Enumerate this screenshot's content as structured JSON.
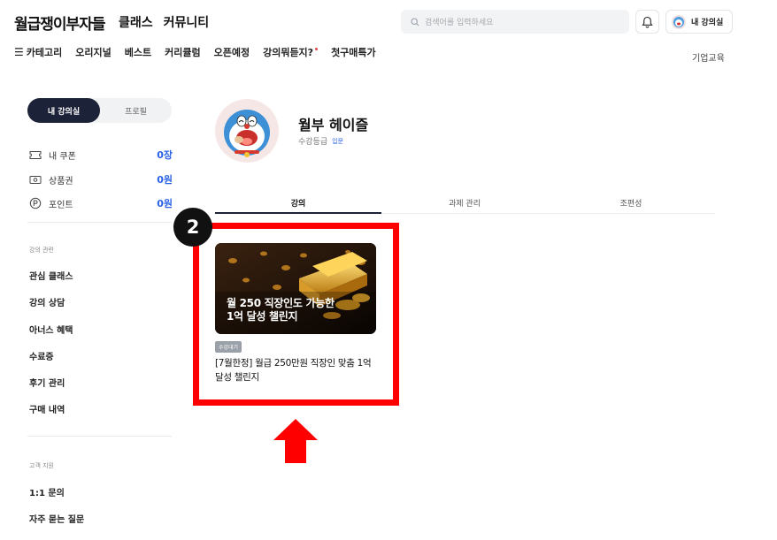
{
  "header": {
    "logo": "월급쟁이부자들",
    "nav": [
      "클래스",
      "커뮤니티"
    ],
    "search_placeholder": "검색어를 입력하세요",
    "my_class_label": "내 강의실"
  },
  "subnav": {
    "items": [
      "카테고리",
      "오리지널",
      "베스트",
      "커리큘럼",
      "오픈예정",
      "강의뭐듣지?",
      "첫구매특가"
    ],
    "corporate": "기업교육"
  },
  "sidebar": {
    "tabs": [
      "내 강의실",
      "프로필"
    ],
    "wallet": [
      {
        "label": "내 쿠폰",
        "value": "0장",
        "icon": "ticket-icon"
      },
      {
        "label": "상품권",
        "value": "0원",
        "icon": "voucher-icon"
      },
      {
        "label": "포인트",
        "value": "0원",
        "icon": "point-icon"
      }
    ],
    "lecture_section": "강의 관련",
    "lecture_items": [
      "관심 클래스",
      "강의 상담",
      "아너스 혜택",
      "수료증",
      "후기 관리",
      "구매 내역"
    ],
    "support_section": "고객 지원",
    "support_items": [
      "1:1 문의",
      "자주 묻는 질문"
    ]
  },
  "profile": {
    "name": "월부 헤이즐",
    "grade_label": "수강등급",
    "grade_value": "입문"
  },
  "content_tabs": [
    "강의",
    "과제 관리",
    "조편성"
  ],
  "annotation": {
    "step": "2"
  },
  "course": {
    "thumb_line1": "월 250 직장인도 가능한",
    "thumb_line2": "1억 달성 챌린지",
    "status": "수강대기",
    "title": "[7월한정] 월급 250만원 직장인 맞춤 1억 달성 챌린지"
  },
  "colors": {
    "accent_blue": "#2a62e6",
    "navy": "#1c2237",
    "highlight_red": "#ff0000",
    "new_dot": "#e5484d"
  }
}
